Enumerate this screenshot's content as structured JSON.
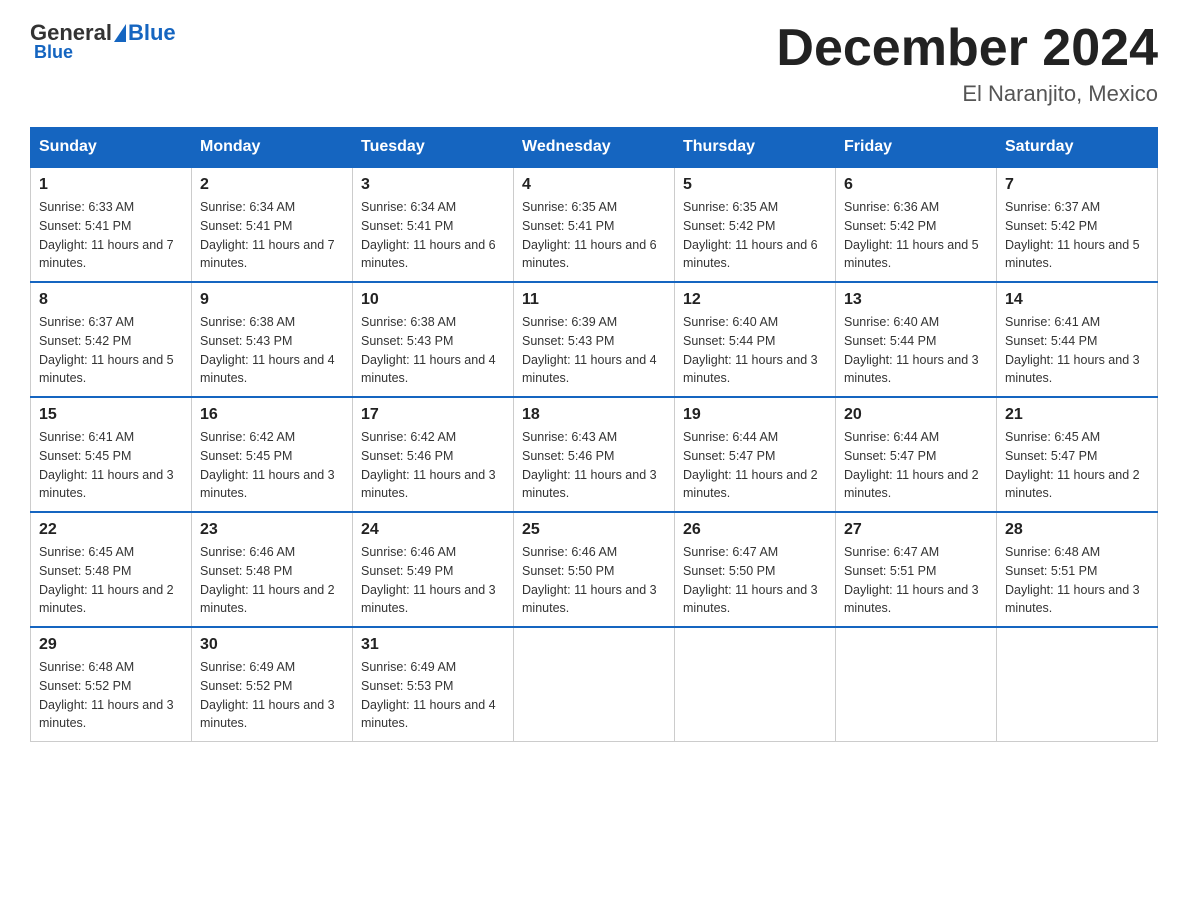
{
  "header": {
    "logo_general": "General",
    "logo_blue": "Blue",
    "month_title": "December 2024",
    "location": "El Naranjito, Mexico"
  },
  "weekdays": [
    "Sunday",
    "Monday",
    "Tuesday",
    "Wednesday",
    "Thursday",
    "Friday",
    "Saturday"
  ],
  "weeks": [
    [
      {
        "day": "1",
        "sunrise": "6:33 AM",
        "sunset": "5:41 PM",
        "daylight": "11 hours and 7 minutes."
      },
      {
        "day": "2",
        "sunrise": "6:34 AM",
        "sunset": "5:41 PM",
        "daylight": "11 hours and 7 minutes."
      },
      {
        "day": "3",
        "sunrise": "6:34 AM",
        "sunset": "5:41 PM",
        "daylight": "11 hours and 6 minutes."
      },
      {
        "day": "4",
        "sunrise": "6:35 AM",
        "sunset": "5:41 PM",
        "daylight": "11 hours and 6 minutes."
      },
      {
        "day": "5",
        "sunrise": "6:35 AM",
        "sunset": "5:42 PM",
        "daylight": "11 hours and 6 minutes."
      },
      {
        "day": "6",
        "sunrise": "6:36 AM",
        "sunset": "5:42 PM",
        "daylight": "11 hours and 5 minutes."
      },
      {
        "day": "7",
        "sunrise": "6:37 AM",
        "sunset": "5:42 PM",
        "daylight": "11 hours and 5 minutes."
      }
    ],
    [
      {
        "day": "8",
        "sunrise": "6:37 AM",
        "sunset": "5:42 PM",
        "daylight": "11 hours and 5 minutes."
      },
      {
        "day": "9",
        "sunrise": "6:38 AM",
        "sunset": "5:43 PM",
        "daylight": "11 hours and 4 minutes."
      },
      {
        "day": "10",
        "sunrise": "6:38 AM",
        "sunset": "5:43 PM",
        "daylight": "11 hours and 4 minutes."
      },
      {
        "day": "11",
        "sunrise": "6:39 AM",
        "sunset": "5:43 PM",
        "daylight": "11 hours and 4 minutes."
      },
      {
        "day": "12",
        "sunrise": "6:40 AM",
        "sunset": "5:44 PM",
        "daylight": "11 hours and 3 minutes."
      },
      {
        "day": "13",
        "sunrise": "6:40 AM",
        "sunset": "5:44 PM",
        "daylight": "11 hours and 3 minutes."
      },
      {
        "day": "14",
        "sunrise": "6:41 AM",
        "sunset": "5:44 PM",
        "daylight": "11 hours and 3 minutes."
      }
    ],
    [
      {
        "day": "15",
        "sunrise": "6:41 AM",
        "sunset": "5:45 PM",
        "daylight": "11 hours and 3 minutes."
      },
      {
        "day": "16",
        "sunrise": "6:42 AM",
        "sunset": "5:45 PM",
        "daylight": "11 hours and 3 minutes."
      },
      {
        "day": "17",
        "sunrise": "6:42 AM",
        "sunset": "5:46 PM",
        "daylight": "11 hours and 3 minutes."
      },
      {
        "day": "18",
        "sunrise": "6:43 AM",
        "sunset": "5:46 PM",
        "daylight": "11 hours and 3 minutes."
      },
      {
        "day": "19",
        "sunrise": "6:44 AM",
        "sunset": "5:47 PM",
        "daylight": "11 hours and 2 minutes."
      },
      {
        "day": "20",
        "sunrise": "6:44 AM",
        "sunset": "5:47 PM",
        "daylight": "11 hours and 2 minutes."
      },
      {
        "day": "21",
        "sunrise": "6:45 AM",
        "sunset": "5:47 PM",
        "daylight": "11 hours and 2 minutes."
      }
    ],
    [
      {
        "day": "22",
        "sunrise": "6:45 AM",
        "sunset": "5:48 PM",
        "daylight": "11 hours and 2 minutes."
      },
      {
        "day": "23",
        "sunrise": "6:46 AM",
        "sunset": "5:48 PM",
        "daylight": "11 hours and 2 minutes."
      },
      {
        "day": "24",
        "sunrise": "6:46 AM",
        "sunset": "5:49 PM",
        "daylight": "11 hours and 3 minutes."
      },
      {
        "day": "25",
        "sunrise": "6:46 AM",
        "sunset": "5:50 PM",
        "daylight": "11 hours and 3 minutes."
      },
      {
        "day": "26",
        "sunrise": "6:47 AM",
        "sunset": "5:50 PM",
        "daylight": "11 hours and 3 minutes."
      },
      {
        "day": "27",
        "sunrise": "6:47 AM",
        "sunset": "5:51 PM",
        "daylight": "11 hours and 3 minutes."
      },
      {
        "day": "28",
        "sunrise": "6:48 AM",
        "sunset": "5:51 PM",
        "daylight": "11 hours and 3 minutes."
      }
    ],
    [
      {
        "day": "29",
        "sunrise": "6:48 AM",
        "sunset": "5:52 PM",
        "daylight": "11 hours and 3 minutes."
      },
      {
        "day": "30",
        "sunrise": "6:49 AM",
        "sunset": "5:52 PM",
        "daylight": "11 hours and 3 minutes."
      },
      {
        "day": "31",
        "sunrise": "6:49 AM",
        "sunset": "5:53 PM",
        "daylight": "11 hours and 4 minutes."
      },
      null,
      null,
      null,
      null
    ]
  ]
}
